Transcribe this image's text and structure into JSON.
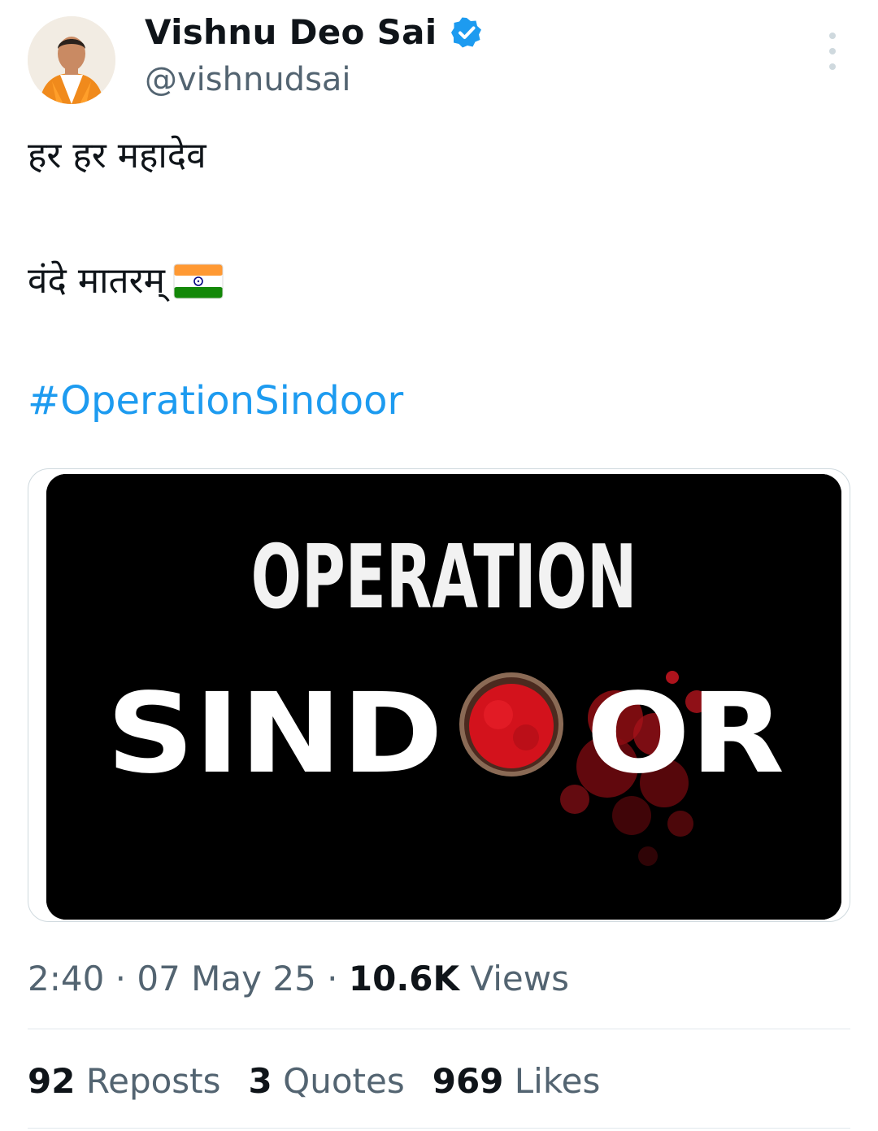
{
  "author": {
    "name": "Vishnu Deo Sai",
    "handle": "@vishnudsai",
    "verified_icon": "verified-badge-icon",
    "avatar": "avatar-photo"
  },
  "tweet": {
    "line1": "हर हर महादेव",
    "line2": "वंदे मातरम्",
    "flag_icon": "india-flag-emoji",
    "hashtag": "#OperationSindoor"
  },
  "media": {
    "title_top": "OPERATION",
    "title_bottom_left": "SIND",
    "title_bottom_right": "OR"
  },
  "meta": {
    "time": "2:40",
    "separator": " · ",
    "date": "07 May 25",
    "views_count": "10.6K",
    "views_label": "Views"
  },
  "stats": {
    "reposts_count": "92",
    "reposts_label": "Reposts",
    "quotes_count": "3",
    "quotes_label": "Quotes",
    "likes_count": "969",
    "likes_label": "Likes"
  },
  "colors": {
    "link": "#1d9bf0",
    "secondary_text": "#536471",
    "primary_text": "#0f1419",
    "sindoor_red": "#d3121c"
  }
}
